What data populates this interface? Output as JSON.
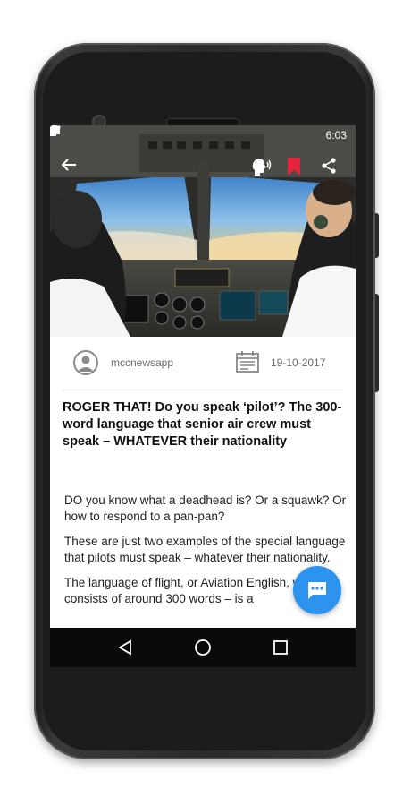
{
  "status_bar": {
    "time": "6:03"
  },
  "app_bar": {
    "back_icon": "arrow-left-icon",
    "listen_icon": "speaking-head-icon",
    "bookmark_icon": "bookmark-icon",
    "share_icon": "share-icon",
    "bookmark_color": "#e5243b"
  },
  "article": {
    "author": "mccnewsapp",
    "date": "19-10-2017",
    "headline": "ROGER THAT! Do you speak ‘pilot’? The 300-word language that senior air crew must speak – WHATEVER their nationality",
    "paragraphs": [
      "DO you know what a deadhead is? Or a squawk? Or how to respond to a pan-pan?",
      "These are just two examples of the special language that pilots must speak – whatever their nationality.",
      "The language of flight, or Aviation English, which consists of around 300 words – is a"
    ]
  },
  "fab": {
    "icon": "chat-bubble-icon",
    "color": "#2c93ee"
  },
  "nav": {
    "back_icon": "triangle-back-icon",
    "home_icon": "circle-home-icon",
    "recents_icon": "square-recents-icon"
  }
}
